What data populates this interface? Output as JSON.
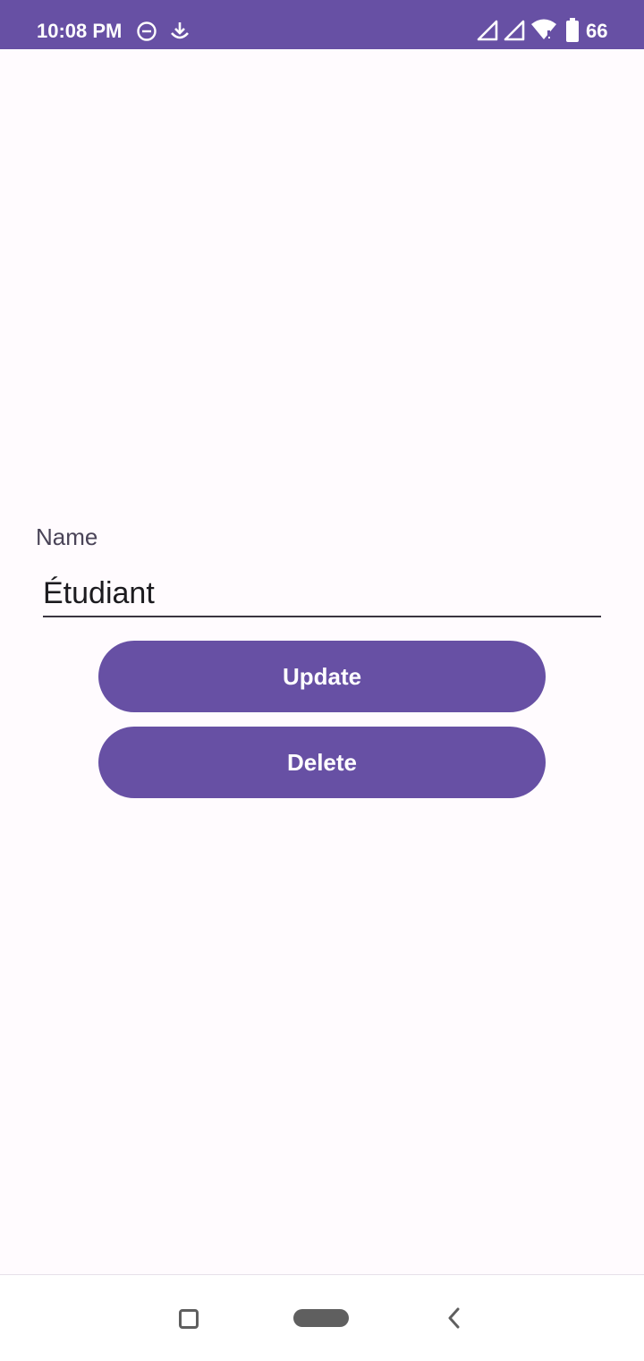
{
  "status_bar": {
    "time": "10:08 PM",
    "battery_level": "66",
    "background_color": "#6750a4",
    "icons": [
      "do-not-disturb-icon",
      "download-icon",
      "signal-icon",
      "signal-icon",
      "wifi-icon",
      "battery-icon"
    ]
  },
  "form": {
    "label": "Name",
    "value": "Étudiant"
  },
  "buttons": {
    "update_label": "Update",
    "delete_label": "Delete",
    "color": "#6750a4"
  },
  "navigation": {
    "icons": [
      "recents-icon",
      "home-icon",
      "back-icon"
    ]
  }
}
